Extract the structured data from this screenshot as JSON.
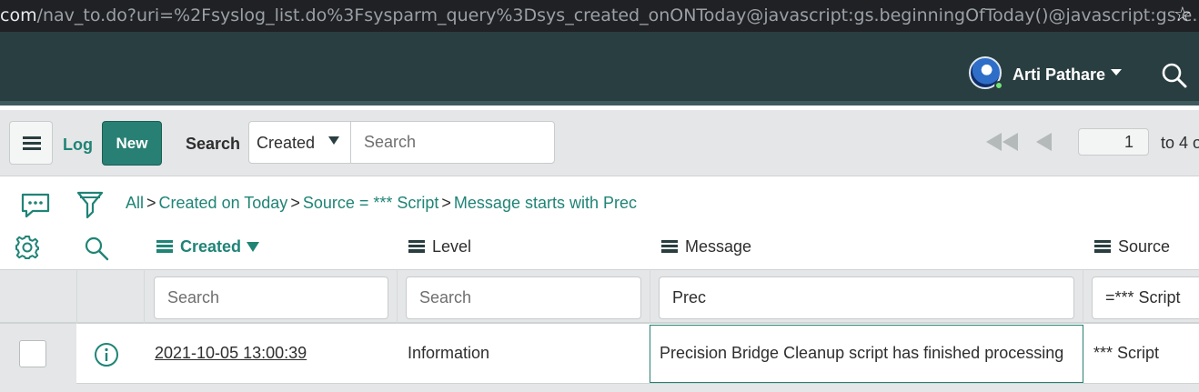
{
  "browser": {
    "url_host": "com",
    "url_path": "/nav_to.do?uri=%2Fsyslog_list.do%3Fsysparm_query%3Dsys_created_onONToday@javascript:gs.beginningOfToday()@javascript:gs.e..."
  },
  "header": {
    "user_name": "Arti Pathare"
  },
  "toolbar": {
    "list_title": "Log",
    "new_label": "New",
    "search_label": "Search",
    "search_field": "Created",
    "search_placeholder": "Search",
    "page_number": "1",
    "page_range": "to 4 o"
  },
  "breadcrumb": {
    "all": "All",
    "items": [
      "Created on Today",
      "Source = *** Script",
      "Message starts with Prec"
    ]
  },
  "columns": {
    "created": "Created",
    "level": "Level",
    "message": "Message",
    "source": "Source"
  },
  "filters": {
    "created_placeholder": "Search",
    "level_placeholder": "Search",
    "message_value": "Prec",
    "source_value": "=*** Script"
  },
  "rows": [
    {
      "created": "2021-10-05 13:00:39",
      "level": "Information",
      "message": "Precision Bridge Cleanup script has finished processing",
      "source": "*** Script"
    }
  ],
  "colors": {
    "header_bg": "#293e40",
    "accent": "#278073",
    "link": "#1f8476"
  }
}
